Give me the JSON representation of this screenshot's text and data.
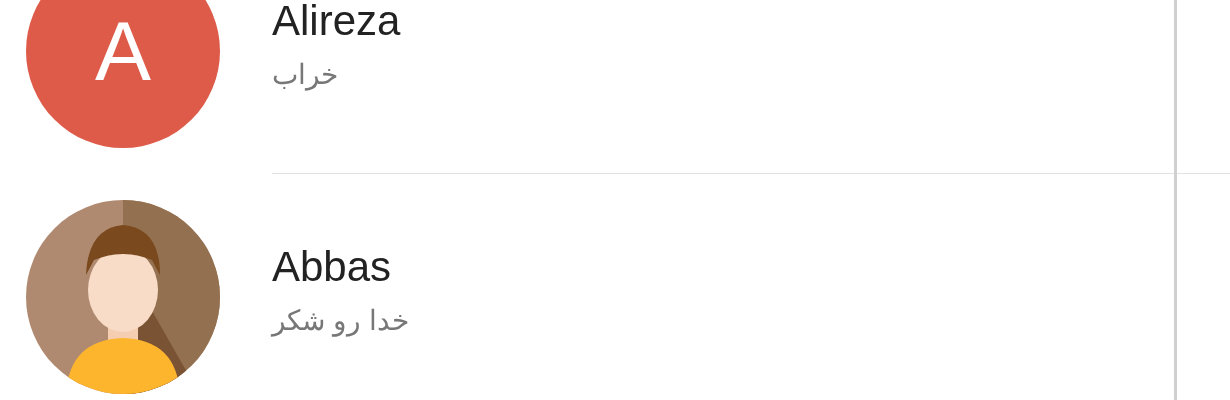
{
  "contacts": [
    {
      "name": "Alireza",
      "message": "خراب",
      "avatar": {
        "kind": "letter",
        "letter": "A",
        "color": "#de5b4a"
      }
    },
    {
      "name": "Abbas",
      "message": "خدا رو شکر",
      "avatar": {
        "kind": "figure"
      }
    }
  ]
}
